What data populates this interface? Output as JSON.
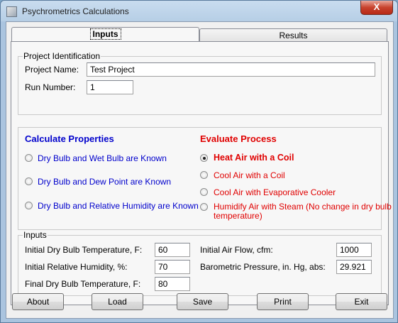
{
  "window": {
    "title": "Psychrometrics Calculations",
    "close_glyph": "X"
  },
  "tabs": [
    {
      "label": "Inputs"
    },
    {
      "label": "Results"
    }
  ],
  "project": {
    "legend": "Project Identification",
    "name_label": "Project Name:",
    "name_value": "Test Project",
    "run_label": "Run Number:",
    "run_value": "1"
  },
  "calculate": {
    "header": "Calculate Properties",
    "options": [
      "Dry Bulb and Wet Bulb are Known",
      "Dry Bulb and Dew Point are Known",
      "Dry Bulb and Relative Humidity are Known"
    ]
  },
  "evaluate": {
    "header": "Evaluate Process",
    "options": [
      "Heat Air with a Coil",
      "Cool Air with a Coil",
      "Cool Air with Evaporative Cooler",
      "Humidify Air with Steam (No change in dry bulb",
      "temperature)"
    ]
  },
  "inputs": {
    "legend": "Inputs",
    "initial_db_label": "Initial Dry Bulb Temperature, F:",
    "initial_db_value": "60",
    "initial_rh_label": "Initial Relative Humidity, %:",
    "initial_rh_value": "70",
    "final_db_label": "Final Dry Bulb Temperature, F:",
    "final_db_value": "80",
    "airflow_label": "Initial Air Flow, cfm:",
    "airflow_value": "1000",
    "pressure_label": "Barometric Pressure, in. Hg, abs:",
    "pressure_value": "29.921"
  },
  "buttons": {
    "about": "About",
    "load": "Load",
    "save": "Save",
    "print": "Print",
    "exit": "Exit"
  },
  "colors": {
    "calculate_header": "#0000cc",
    "evaluate_header": "#e00000"
  }
}
